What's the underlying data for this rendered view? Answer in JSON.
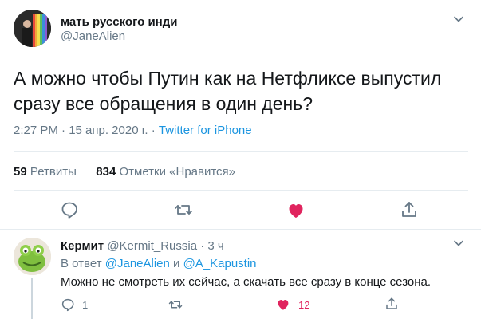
{
  "tweet": {
    "author_name": "мать русского инди",
    "author_handle": "@JaneAlien",
    "text": "А можно чтобы Путин как на Нетфликсе выпустил сразу все обращения в один день?",
    "time": "2:27 PM · 15 апр. 2020 г. · ",
    "source": "Twitter for iPhone",
    "retweets_count": "59",
    "retweets_label": "Ретвиты",
    "likes_count": "834",
    "likes_label": "Отметки «Нравится»"
  },
  "reply": {
    "author_name": "Кермит",
    "author_handle": "@Kermit_Russia",
    "time": "· 3 ч",
    "reply_to_prefix": "В ответ ",
    "reply_to_user1": "@JaneAlien",
    "reply_to_and": " и ",
    "reply_to_user2": "@A_Kapustin",
    "text": "Можно не смотреть их сейчас, а скачать все сразу в конце сезона.",
    "replies_count": "1",
    "likes_count": "12"
  },
  "colors": {
    "link": "#1b95e0",
    "liked": "#e0245e",
    "muted": "#657786"
  },
  "icons": [
    "chevron-down-icon",
    "reply-icon",
    "retweet-icon",
    "heart-icon",
    "share-icon"
  ]
}
